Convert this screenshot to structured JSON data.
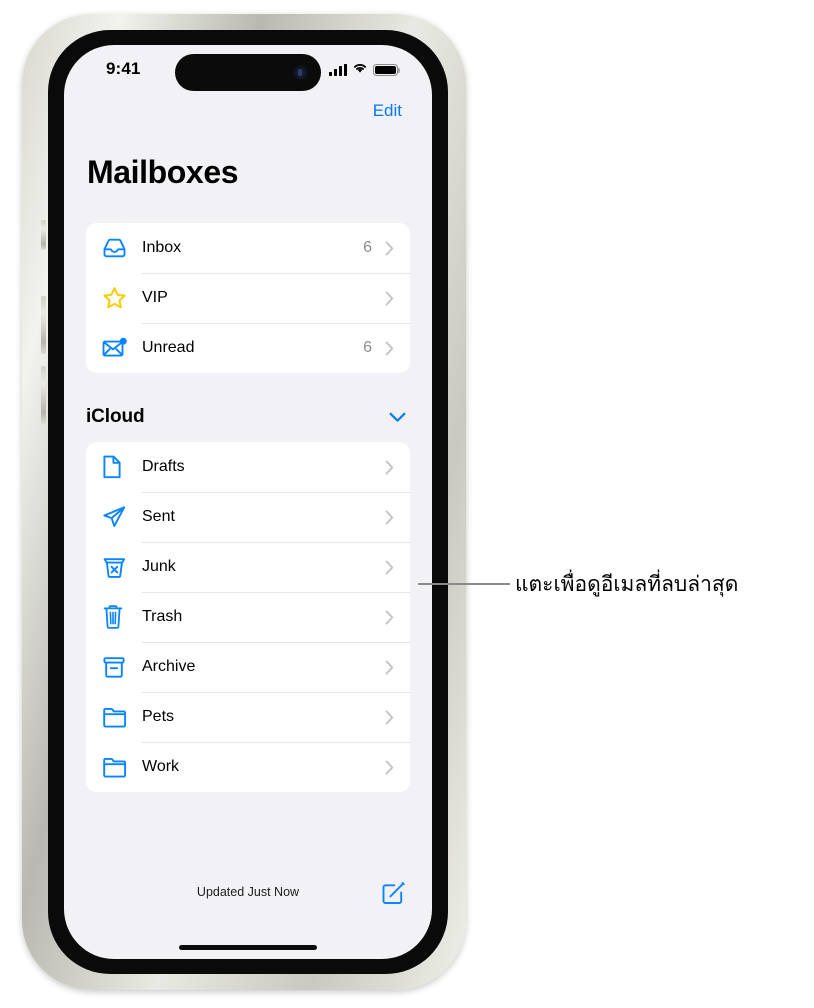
{
  "status_bar": {
    "time": "9:41",
    "signal_icon": "cellular-bars-icon",
    "wifi_icon": "wifi-icon",
    "battery_icon": "battery-full-icon"
  },
  "nav": {
    "edit_label": "Edit"
  },
  "header": {
    "title": "Mailboxes"
  },
  "primary_list": {
    "items": [
      {
        "label": "Inbox",
        "count": "6",
        "icon": "inbox-tray-icon"
      },
      {
        "label": "VIP",
        "count": "",
        "icon": "star-icon"
      },
      {
        "label": "Unread",
        "count": "6",
        "icon": "unread-envelope-icon"
      }
    ]
  },
  "icloud_section": {
    "title": "iCloud",
    "collapse_icon": "chevron-down-icon",
    "items": [
      {
        "label": "Drafts",
        "count": "",
        "icon": "document-icon"
      },
      {
        "label": "Sent",
        "count": "",
        "icon": "paper-plane-icon"
      },
      {
        "label": "Junk",
        "count": "",
        "icon": "junk-bin-icon"
      },
      {
        "label": "Trash",
        "count": "",
        "icon": "trash-icon"
      },
      {
        "label": "Archive",
        "count": "",
        "icon": "archive-box-icon"
      },
      {
        "label": "Pets",
        "count": "",
        "icon": "folder-icon"
      },
      {
        "label": "Work",
        "count": "",
        "icon": "folder-icon"
      }
    ]
  },
  "toolbar": {
    "status_text": "Updated Just Now",
    "compose_icon": "compose-icon"
  },
  "callout": {
    "text": "แตะเพื่อดูอีเมลที่ลบล่าสุด"
  },
  "colors": {
    "accent": "#007aff",
    "star": "#ffcc00",
    "screen_bg": "#f2f2f6",
    "card_bg": "#ffffff",
    "secondary_text": "#8b8b90"
  }
}
